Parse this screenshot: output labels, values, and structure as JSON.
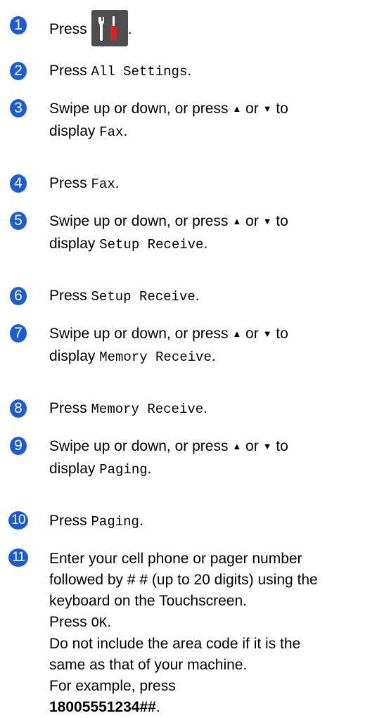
{
  "steps": [
    {
      "n": "1",
      "press": "Press",
      "end": "."
    },
    {
      "n": "2",
      "press": "Press",
      "ui": "All Settings",
      "end": "."
    },
    {
      "n": "3",
      "pre": "Swipe up or down, or press",
      "or": "or",
      "to": "to",
      "display": "display",
      "ui": "Fax",
      "end": "."
    },
    {
      "n": "4",
      "press": "Press",
      "ui": "Fax",
      "end": "."
    },
    {
      "n": "5",
      "pre": "Swipe up or down, or press",
      "or": "or",
      "to": "to",
      "display": "display",
      "ui": "Setup Receive",
      "end": "."
    },
    {
      "n": "6",
      "press": "Press",
      "ui": "Setup Receive",
      "end": "."
    },
    {
      "n": "7",
      "pre": "Swipe up or down, or press",
      "or": "or",
      "to": "to",
      "display": "display",
      "ui": "Memory Receive",
      "end": "."
    },
    {
      "n": "8",
      "press": "Press",
      "ui": "Memory Receive",
      "end": "."
    },
    {
      "n": "9",
      "pre": "Swipe up or down, or press",
      "or": "or",
      "to": "to",
      "display": "display",
      "ui": "Paging",
      "end": "."
    },
    {
      "n": "10",
      "press": "Press",
      "ui": "Paging",
      "end": "."
    },
    {
      "n": "11",
      "l1": "Enter your cell phone or pager number",
      "l2": "followed by # # (up to 20 digits) using the",
      "l3": "keyboard on the Touchscreen.",
      "press": "Press",
      "ok": "OK",
      "end": ".",
      "l5": "Do not include the area code if it is the",
      "l6": "same as that of your machine.",
      "l7": "For example, press",
      "example": "18005551234##",
      "end2": "."
    }
  ],
  "icons": {
    "up": "▲",
    "down": "▼",
    "settings": "settings-tools-icon"
  },
  "colors": {
    "step_badge": "#1a5bd6",
    "tool_button": "#4e4e4e"
  }
}
